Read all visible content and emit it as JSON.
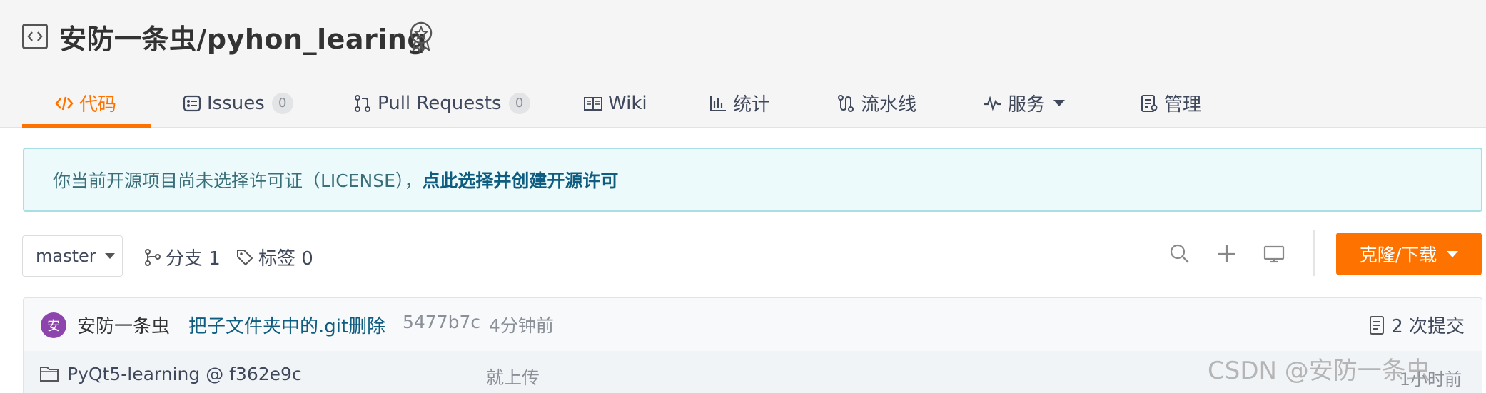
{
  "repo": {
    "title": "安防一条虫/pyhon_learing"
  },
  "tabs": [
    {
      "label": "代码",
      "icon": "code-icon",
      "active": true
    },
    {
      "label": "Issues",
      "icon": "issues-icon",
      "badge": "0"
    },
    {
      "label": "Pull Requests",
      "icon": "pull-request-icon",
      "badge": "0"
    },
    {
      "label": "Wiki",
      "icon": "wiki-icon"
    },
    {
      "label": "统计",
      "icon": "chart-icon"
    },
    {
      "label": "流水线",
      "icon": "pipeline-icon"
    },
    {
      "label": "服务",
      "icon": "pulse-icon",
      "dropdown": true
    },
    {
      "label": "管理",
      "icon": "manage-icon"
    }
  ],
  "license": {
    "text": "你当前开源项目尚未选择许可证（LICENSE），",
    "link": "点此选择并创建开源许可"
  },
  "branch": {
    "selected": "master",
    "branches_label": "分支 1",
    "tags_label": "标签 0"
  },
  "actions": {
    "clone_label": "克隆/下载"
  },
  "commit": {
    "avatar_letter": "安",
    "author": "安防一条虫",
    "message": "把子文件夹中的.git删除",
    "hash": "5477b7c",
    "time": "4分钟前",
    "count_label": "2 次提交"
  },
  "files": [
    {
      "name": "PyQt5-learning @ f362e9c",
      "message": "就上传",
      "time": "1小时前",
      "icon": "folder-icon"
    }
  ],
  "watermark": "CSDN @安防一条虫",
  "colors": {
    "accent": "#fe7300",
    "link": "#0e5d80",
    "license_bg": "#edfafb",
    "avatar": "#8e44ad"
  }
}
